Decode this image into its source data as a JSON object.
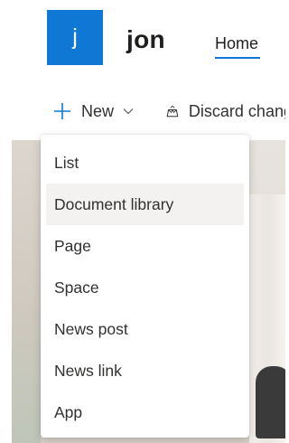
{
  "site": {
    "logo_letter": "j",
    "title": "jon",
    "nav": {
      "home_label": "Home"
    },
    "colors": {
      "accent": "#0f78d4"
    }
  },
  "commandbar": {
    "new_label": "New",
    "new_icon": "plus-icon",
    "new_chevron_icon": "chevron-down-icon",
    "discard_label": "Discard changes",
    "discard_icon": "discard-icon"
  },
  "menu": {
    "items": [
      {
        "label": "List"
      },
      {
        "label": "Document library",
        "hovered": true
      },
      {
        "label": "Page"
      },
      {
        "label": "Space"
      },
      {
        "label": "News post"
      },
      {
        "label": "News link"
      },
      {
        "label": "App"
      }
    ]
  }
}
